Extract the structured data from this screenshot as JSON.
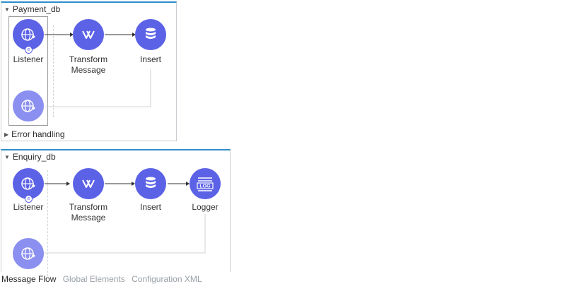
{
  "flows": [
    {
      "name": "Payment_db",
      "nodes": [
        {
          "label": "Listener",
          "icon": "globe-listener-icon"
        },
        {
          "label": "Transform\nMessage",
          "icon": "transform-icon"
        },
        {
          "label": "Insert",
          "icon": "database-icon"
        }
      ],
      "response_icon": "globe-response-icon",
      "error_handling_label": "Error handling"
    },
    {
      "name": "Enquiry_db",
      "nodes": [
        {
          "label": "Listener",
          "icon": "globe-listener-icon"
        },
        {
          "label": "Transform\nMessage",
          "icon": "transform-icon"
        },
        {
          "label": "Insert",
          "icon": "database-icon"
        },
        {
          "label": "Logger",
          "icon": "logger-icon",
          "icon_text": "LOG"
        }
      ],
      "response_icon": "globe-response-icon"
    }
  ],
  "tabs": [
    {
      "label": "Message Flow",
      "active": true
    },
    {
      "label": "Global Elements",
      "active": false
    },
    {
      "label": "Configuration XML",
      "active": false
    }
  ],
  "colors": {
    "node": "#5c62e6",
    "node_faded": "#8a8ff0",
    "flow_header_border": "#2f8fc9"
  }
}
